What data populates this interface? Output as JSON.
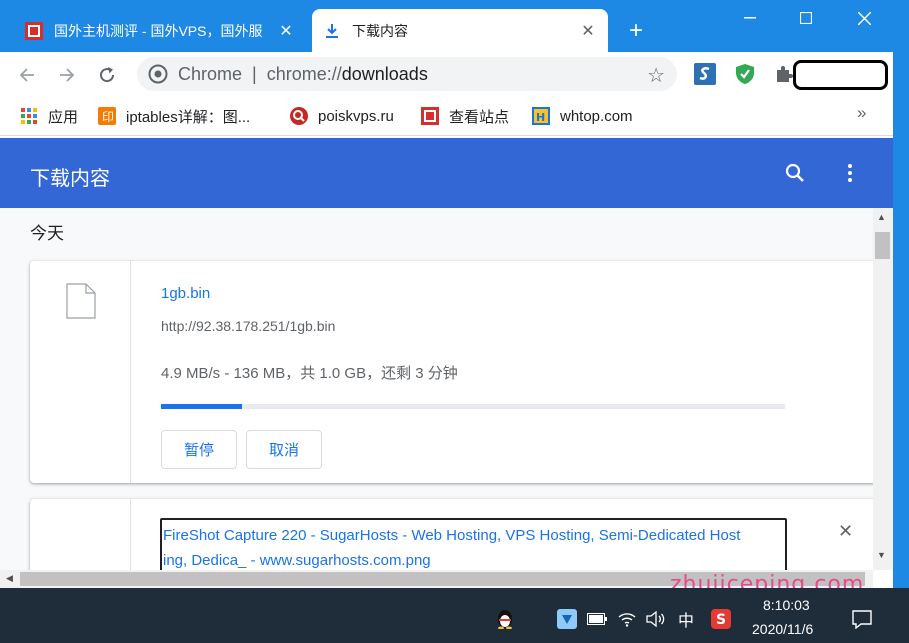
{
  "browser": {
    "tabs": [
      {
        "title": "国外主机测评 - 国外VPS，国外服",
        "active": false
      },
      {
        "title": "下载内容",
        "active": true
      }
    ],
    "omnibox": {
      "chip": "Chrome",
      "separator": "|",
      "scheme": "chrome://",
      "path": "downloads"
    }
  },
  "bookmarks": [
    {
      "label": "应用",
      "icon": "apps-grid-icon"
    },
    {
      "label": "iptables详解：图...",
      "icon": "orange-bookmark-icon"
    },
    {
      "label": "poiskvps.ru",
      "icon": "poiskvps-icon"
    },
    {
      "label": "查看站点",
      "icon": "red-bookmark-icon"
    },
    {
      "label": "whtop.com",
      "icon": "whtop-icon"
    }
  ],
  "bookmarks_more": "»",
  "downloads": {
    "title": "下载内容",
    "date_group": "今天",
    "items": [
      {
        "filename": "1gb.bin",
        "url": "http://92.38.178.251/1gb.bin",
        "status": "4.9 MB/s - 136 MB，共 1.0 GB，还剩 3 分钟",
        "progress": 0.13,
        "pause_label": "暂停",
        "cancel_label": "取消"
      },
      {
        "filename_line1": "FireShot Capture 220 - SugarHosts - Web Hosting, VPS Hosting, Semi-Dedicated Host",
        "filename_line2": "ing, Dedica_ - www.sugarhosts.com.png"
      }
    ]
  },
  "taskbar": {
    "ime": "中",
    "time": "8:10:03",
    "date": "2020/11/6"
  },
  "watermark": "zhujiceping.com",
  "colors": {
    "titlebar": "#1e88e5",
    "header": "#3367d6",
    "link": "#1a73e8",
    "taskbar": "#1f2c3a"
  }
}
